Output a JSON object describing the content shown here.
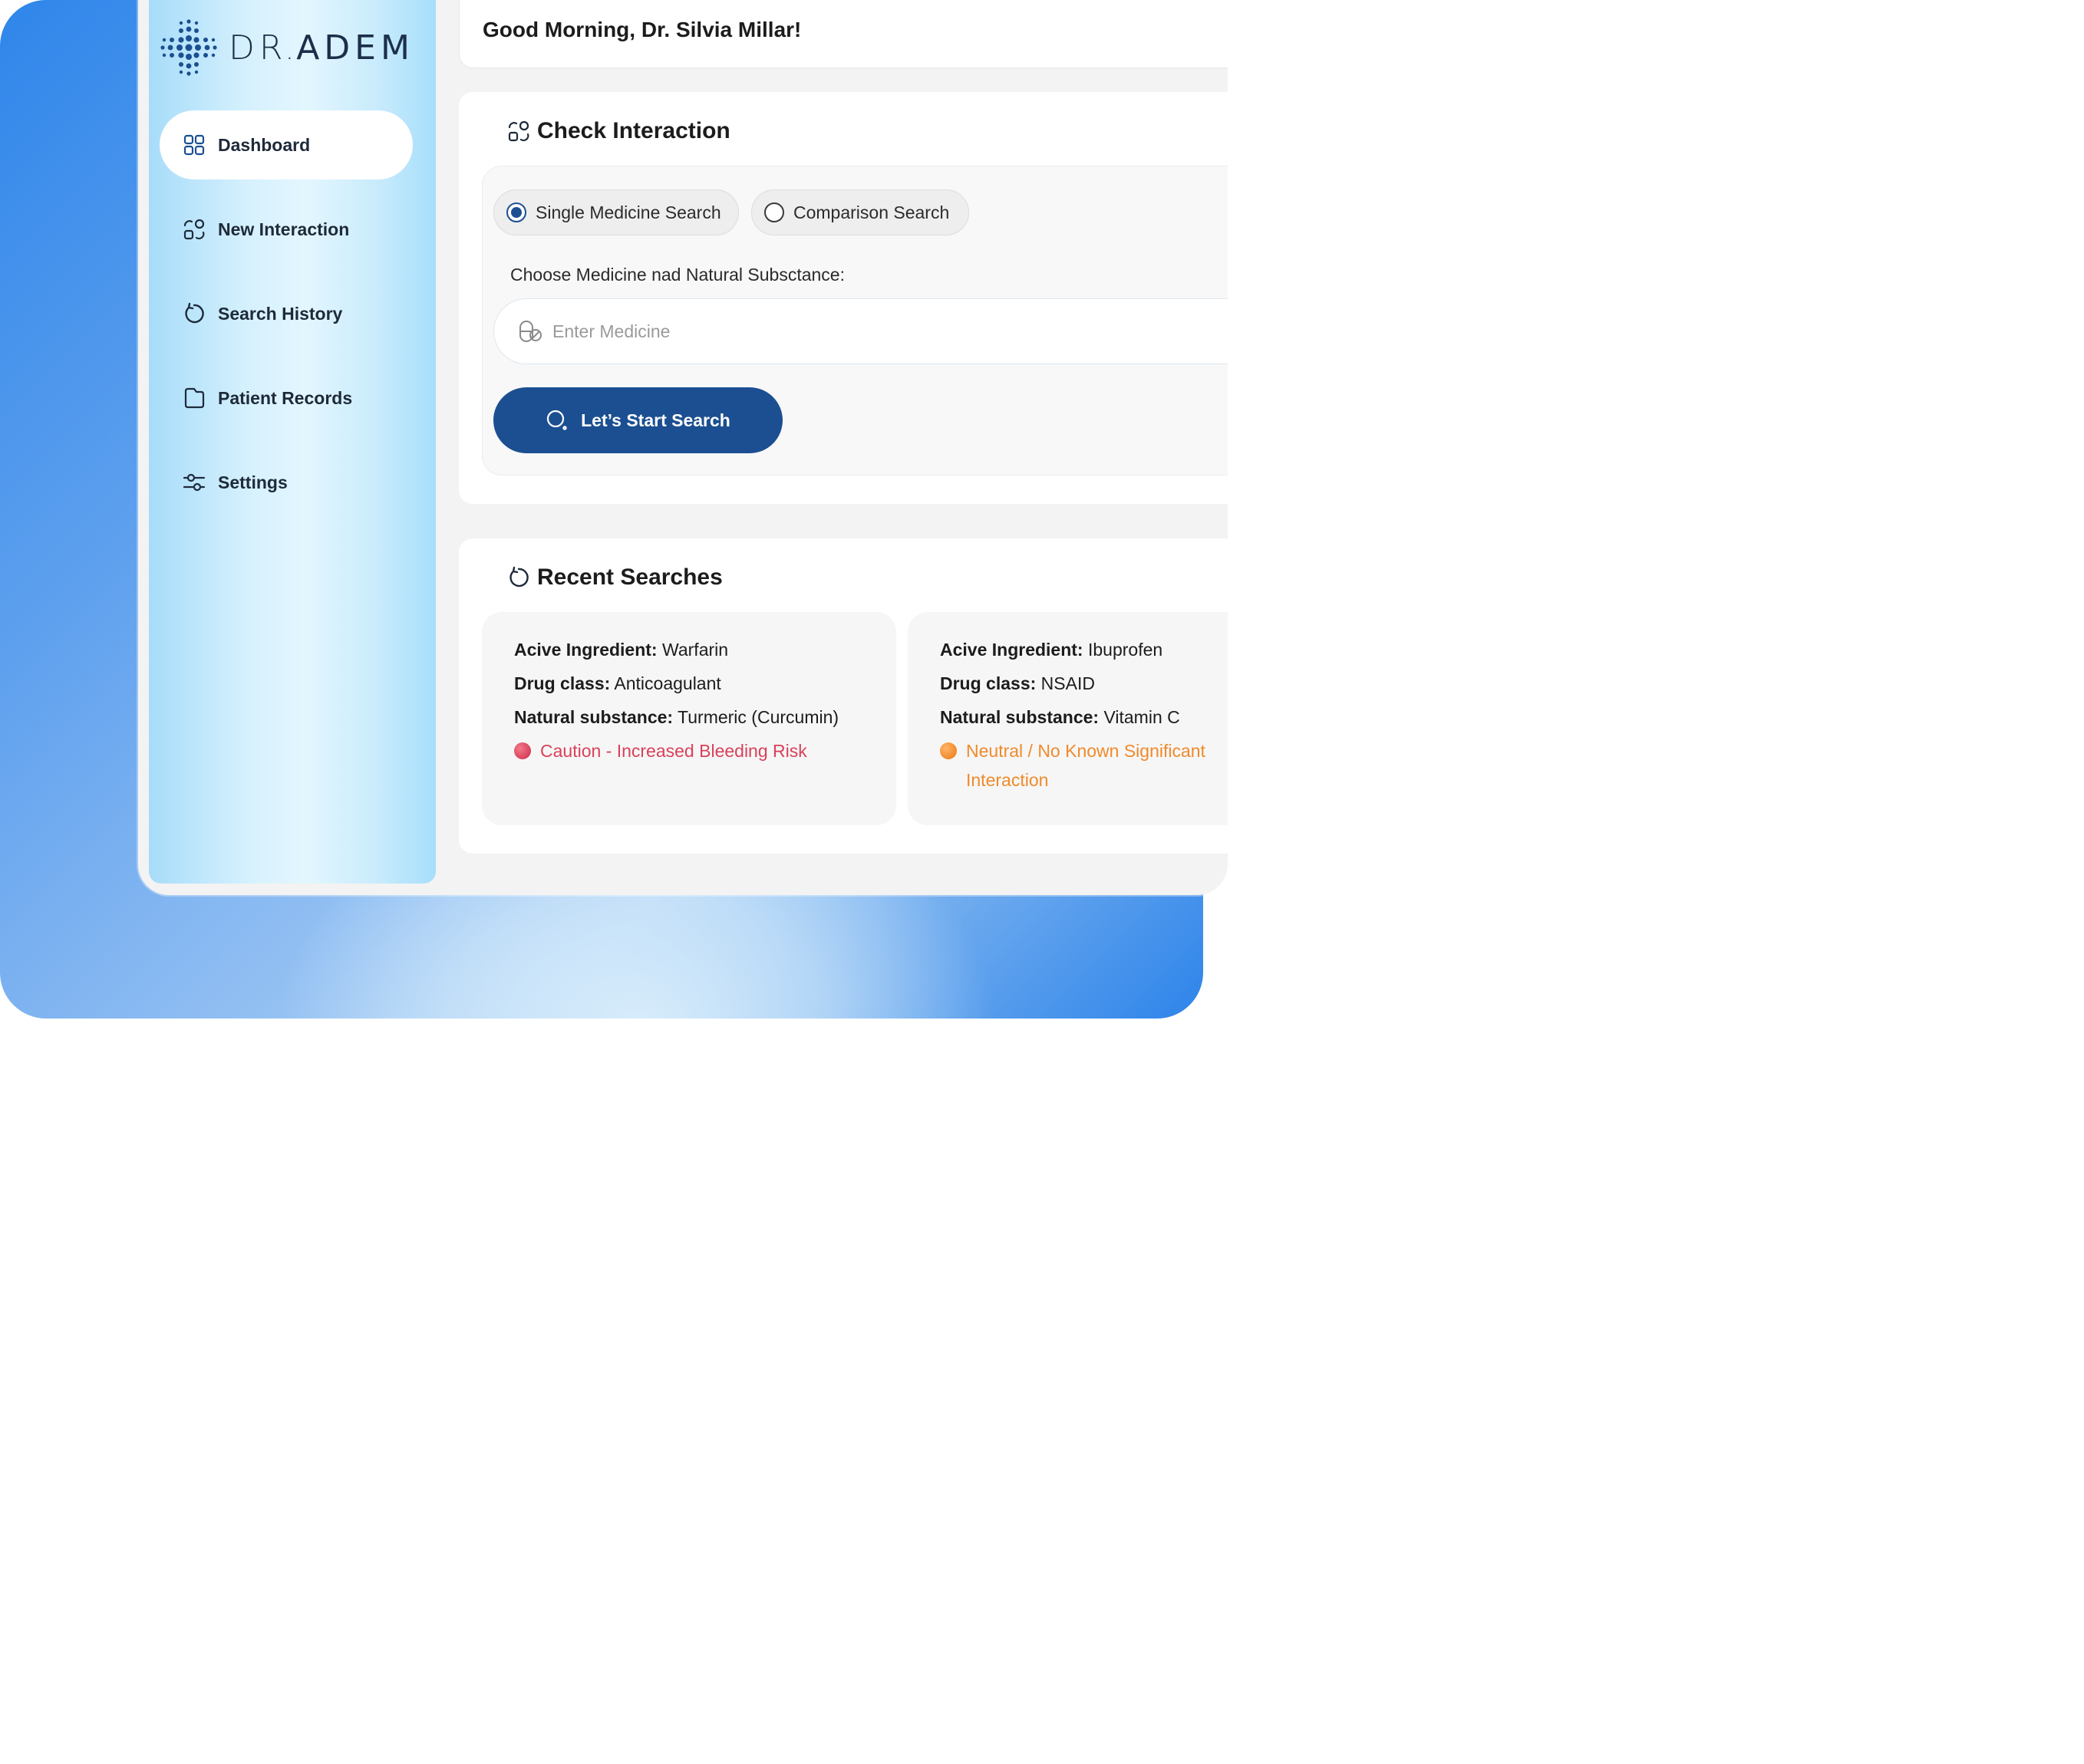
{
  "app": {
    "logo_prefix": "DR",
    "logo_sep": ".",
    "logo_name": "ADEM"
  },
  "sidebar": {
    "items": [
      {
        "label": "Dashboard",
        "icon": "grid-icon",
        "active": true
      },
      {
        "label": "New Interaction",
        "icon": "interaction-icon",
        "active": false
      },
      {
        "label": "Search History",
        "icon": "history-icon",
        "active": false
      },
      {
        "label": "Patient Records",
        "icon": "folder-icon",
        "active": false
      },
      {
        "label": "Settings",
        "icon": "sliders-icon",
        "active": false
      }
    ]
  },
  "header": {
    "greeting": "Good Morning, Dr. Silvia Millar!"
  },
  "check": {
    "title": "Check Interaction",
    "options": [
      {
        "label": "Single Medicine Search",
        "selected": true
      },
      {
        "label": "Comparison Search",
        "selected": false
      }
    ],
    "field_label": "Choose Medicine nad Natural Subsctance:",
    "input_placeholder": "Enter Medicine",
    "input_value": "",
    "button_label": "Let’s Start Search"
  },
  "recent": {
    "title": "Recent Searches",
    "items": [
      {
        "ingredient_label": "Acive Ingredient:",
        "ingredient": "Warfarin",
        "class_label": "Drug class:",
        "drug_class": "Anticoagulant",
        "natural_label": "Natural substance:",
        "natural": "Turmeric (Curcumin)",
        "status": "Caution - Increased Bleeding Risk",
        "status_color": "#d9415a"
      },
      {
        "ingredient_label": "Acive Ingredient:",
        "ingredient": "Ibuprofen",
        "class_label": "Drug class:",
        "drug_class": "NSAID",
        "natural_label": "Natural substance:",
        "natural": "Vitamin C",
        "status": "Neutral / No Known Significant Interaction",
        "status_color": "#f08a2a"
      }
    ]
  },
  "colors": {
    "primary": "#1b4f91",
    "caution": "#d9415a",
    "neutral": "#f08a2a"
  }
}
